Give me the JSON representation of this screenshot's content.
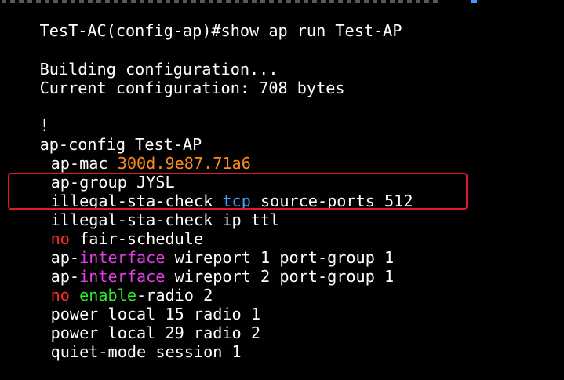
{
  "colors": {
    "background": "#000000",
    "text": "#ffffff",
    "value_orange": "#ff8c1a",
    "keyword_blue": "#3aa0ff",
    "keyword_magenta": "#e23ee8",
    "keyword_red": "#ff2a2a",
    "keyword_green": "#2ee82e",
    "highlight_box": "#e0192b"
  },
  "terminal": {
    "prompt_line": "TesT-AC(config-ap)#show ap run Test-AP",
    "building": "Building configuration...",
    "current_config": "Current configuration: 708 bytes",
    "bang": "!",
    "ap_config": "ap-config Test-AP",
    "ap_mac_key": "ap-mac ",
    "ap_mac_value": "300d.9e87.71a6",
    "ap_group": "ap-group JYSL",
    "illegal1_a": "illegal-sta-check ",
    "illegal1_b": "tcp",
    "illegal1_c": " source-ports 512",
    "illegal2": "illegal-sta-check ip ttl",
    "fair_no": "no",
    "fair_rest": " fair-schedule",
    "ap_interface1_a": "ap-",
    "ap_interface1_b": "interface",
    "ap_interface1_c": " wireport 1 port-group 1",
    "ap_interface2_a": "ap-",
    "ap_interface2_b": "interface",
    "ap_interface2_c": " wireport 2 port-group 1",
    "radio_no": "no",
    "radio_enable": " enable",
    "radio_rest": "-radio 2",
    "power1": "power local 15 radio 1",
    "power2": "power local 29 radio 2",
    "quiet": "quiet-mode session 1"
  }
}
